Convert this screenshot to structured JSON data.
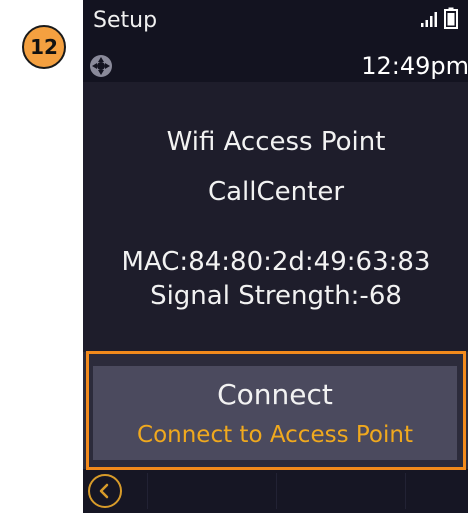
{
  "annotation": {
    "step_number": "12"
  },
  "status_bar": {
    "app_title": "Setup",
    "time": "12:49pm",
    "icons": [
      "signal-icon",
      "battery-icon",
      "nav-icon"
    ]
  },
  "details": {
    "type_label": "Wifi Access Point",
    "ssid": "CallCenter",
    "mac": "MAC:84:80:2d:49:63:83",
    "signal_strength": "Signal Strength:-68"
  },
  "option": {
    "label": "Connect",
    "description": "Connect to Access Point"
  },
  "softkeys": {
    "back_icon": "back-arrow-icon"
  },
  "colors": {
    "screen_bg": "#1e1d2b",
    "status_bg": "#131320",
    "option_bg": "#4b4a5e",
    "accent": "#f0a91e",
    "highlight": "#f28a1c",
    "badge": "#f4a040"
  }
}
